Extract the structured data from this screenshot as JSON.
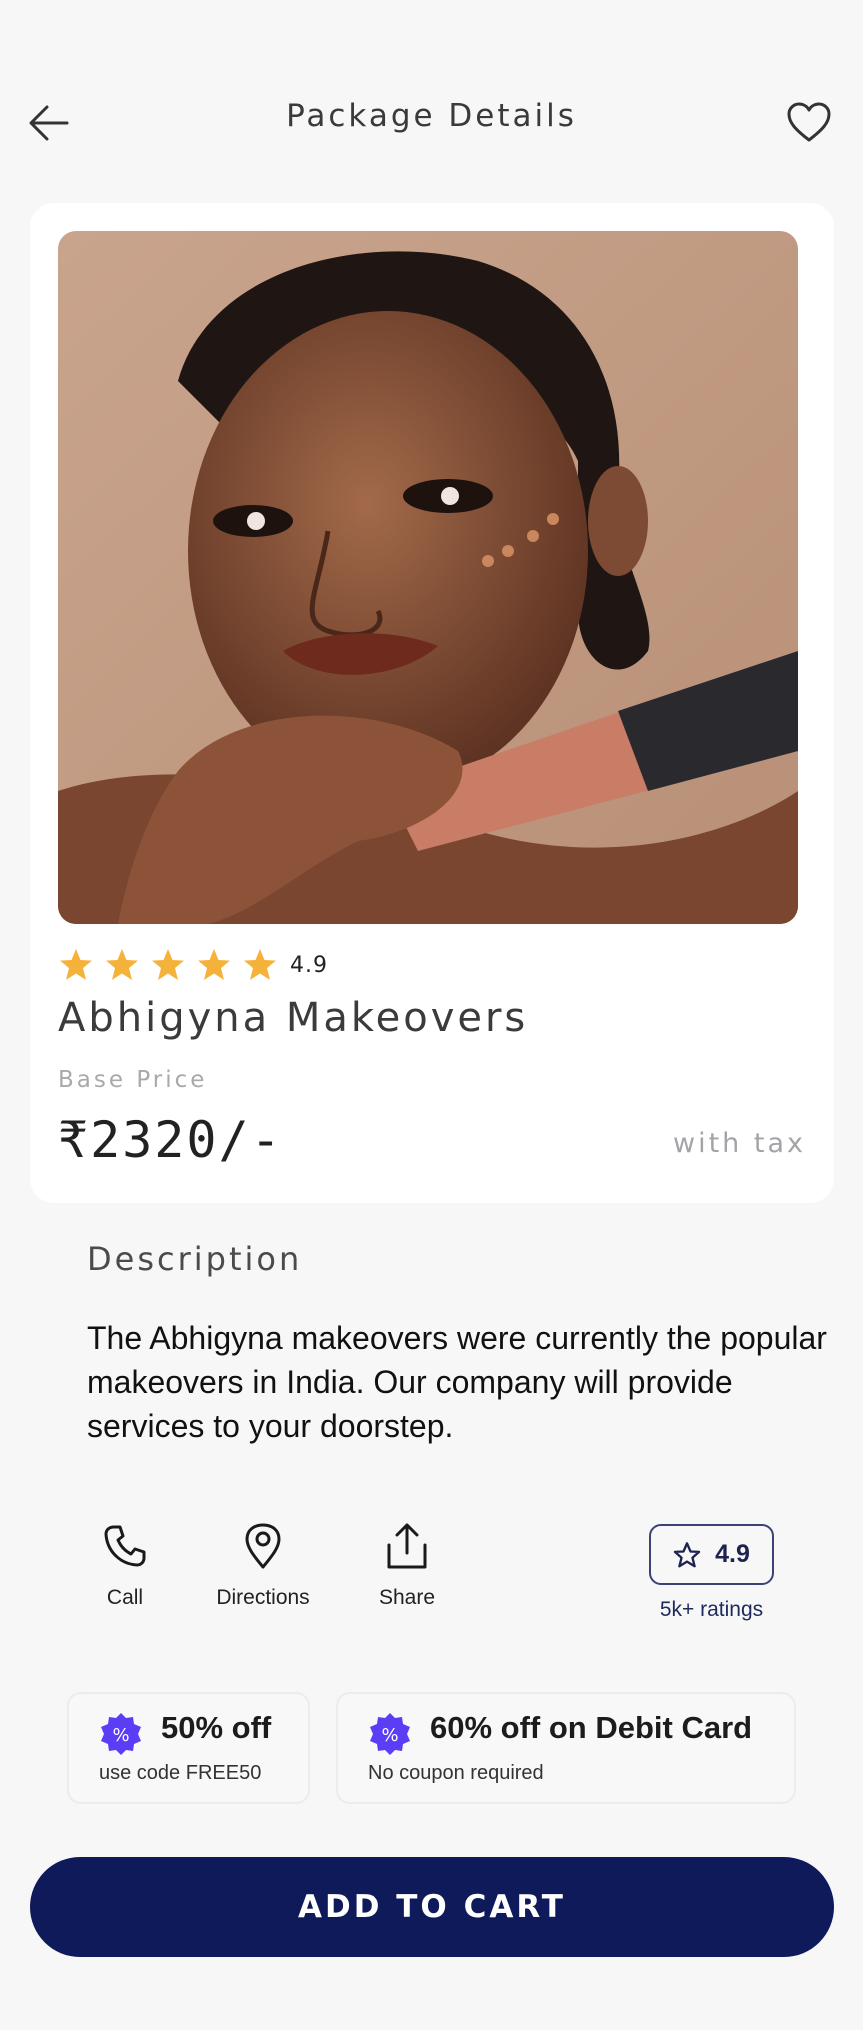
{
  "header": {
    "title": "Package Details",
    "back_icon": "arrow-left-icon",
    "favorite_icon": "heart-icon"
  },
  "product": {
    "image_icon": "model-portrait-image",
    "rating": "4.9",
    "stars_filled": 5,
    "star_color": "#f5b23b",
    "name": "Abhigyna Makeovers",
    "base_price_label": "Base Price",
    "price": "₹2320/-",
    "tax_note": "with tax"
  },
  "description": {
    "heading": "Description",
    "body": "The Abhigyna makeovers were currently the popular makeovers in India. Our company will provide services to your doorstep."
  },
  "actions": [
    {
      "label": "Call",
      "icon": "phone-icon"
    },
    {
      "label": "Directions",
      "icon": "map-pin-icon"
    },
    {
      "label": "Share",
      "icon": "share-icon"
    }
  ],
  "rating_pill": {
    "value": "4.9",
    "icon": "star-outline-icon",
    "count_label": "5k+ ratings"
  },
  "offers": [
    {
      "title": "50% off",
      "subtitle": "use code FREE50",
      "icon": "discount-badge-icon"
    },
    {
      "title": "60% off on Debit Card",
      "subtitle": "No coupon required",
      "icon": "discount-badge-icon"
    }
  ],
  "cta": {
    "label": "ADD TO CART",
    "color": "#0e1a5a"
  },
  "accent_color": "#5b3df5"
}
